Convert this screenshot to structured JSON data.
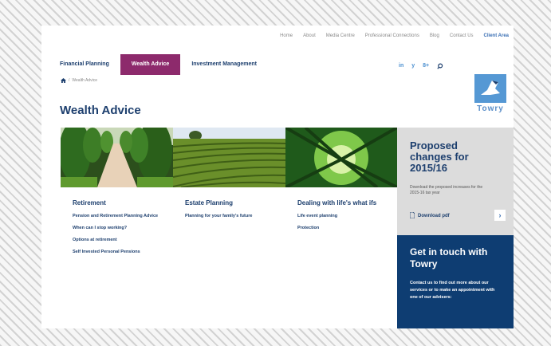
{
  "topnav": [
    "Home",
    "About",
    "Media Centre",
    "Professional Connections",
    "Blog",
    "Contact Us",
    "Client Area"
  ],
  "mainnav": [
    "Financial Planning",
    "Wealth Advice",
    "Investment Management"
  ],
  "social": {
    "linkedin": "in",
    "twitter": "y",
    "google": "8+",
    "search_icon": "magnifier"
  },
  "breadcrumb": {
    "home_icon": "house",
    "separator": "/",
    "current": "Wealth Advice"
  },
  "logo": {
    "text": "Towry"
  },
  "page_title": "Wealth Advice",
  "columns": [
    {
      "title": "Retirement",
      "links": [
        "Pension and Retirement Planning Advice",
        "When can I stop working?",
        "Options at retirement",
        "Self Invested Personal Pensions"
      ]
    },
    {
      "title": "Estate Planning",
      "links": [
        "Planning for your family's future"
      ]
    },
    {
      "title": "Dealing with life's what ifs",
      "links": [
        "Life event planning",
        "Protection"
      ]
    }
  ],
  "promo": {
    "title": "Proposed changes for 2015/16",
    "body": "Download the proposed increases for the 2015-16 tax year",
    "download": "Download pdf",
    "arrow": "›"
  },
  "contact": {
    "title": "Get in touch with Towry",
    "body": "Contact us to find out more about our services or to make an appointment with one of our advisers:"
  },
  "colors": {
    "navy": "#1d3f6e",
    "accent": "#8d2a6c",
    "link_blue": "#3a6fb4",
    "promo_gray": "#dcdcdc",
    "promo_blue": "#0e3d72"
  }
}
